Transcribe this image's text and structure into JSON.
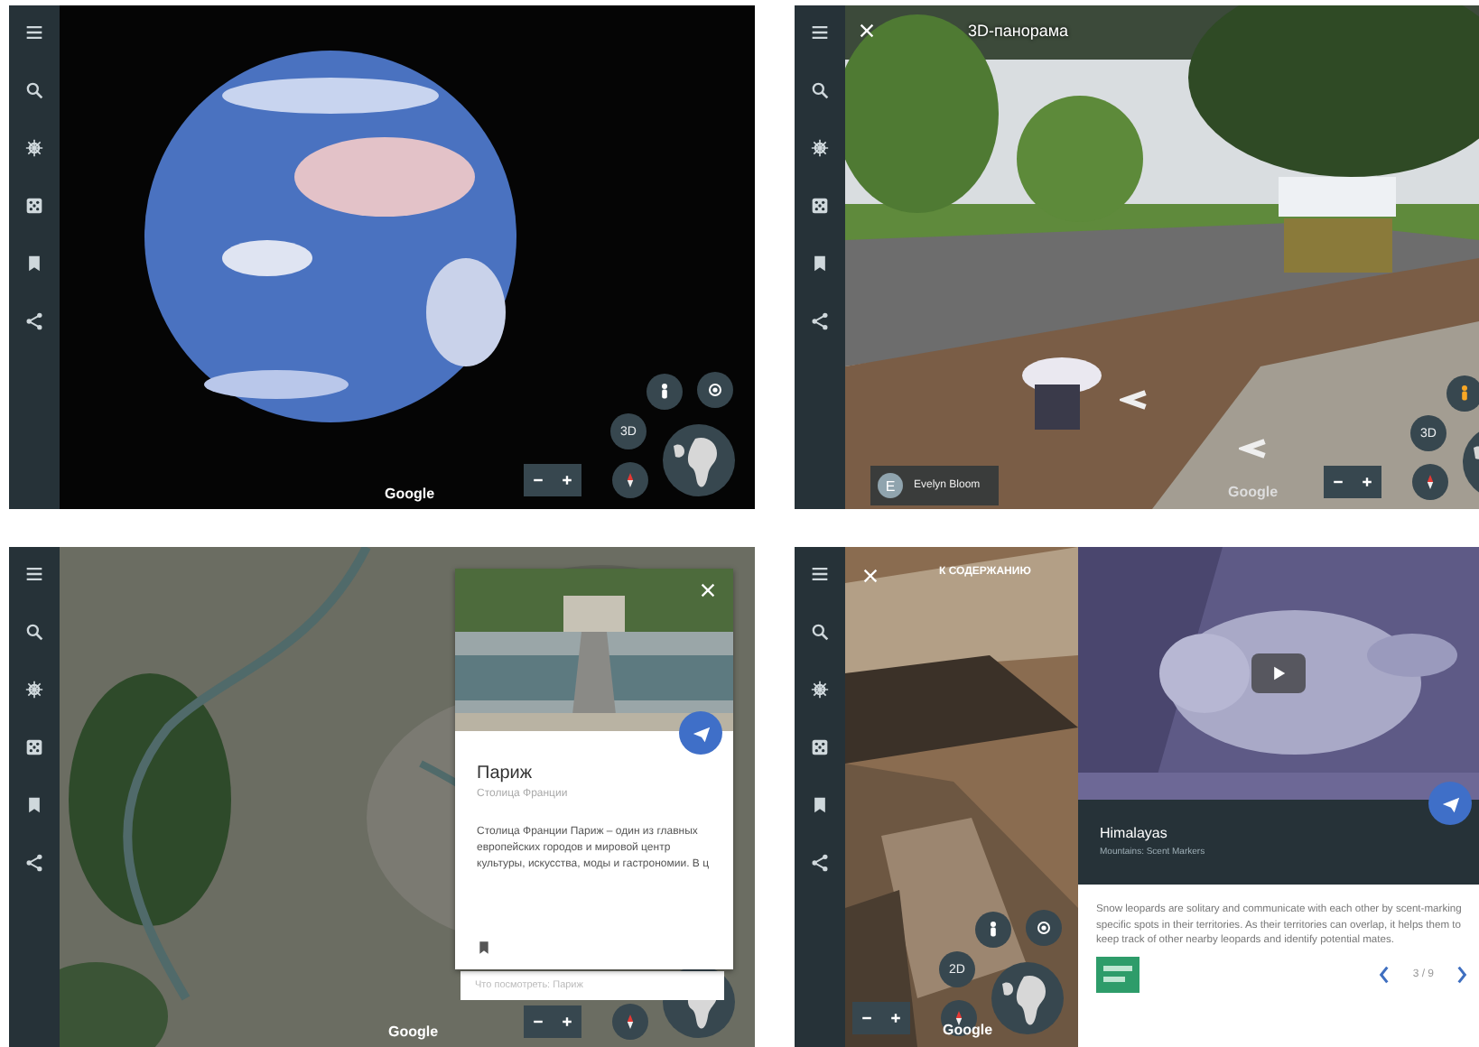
{
  "panels": [
    {
      "kind": "globe",
      "controls": {
        "mode": "3D"
      },
      "logo": "Google"
    },
    {
      "kind": "panorama",
      "title": "3D-панорама",
      "author": {
        "initial": "E",
        "name": "Evelyn Bloom"
      },
      "controls": {
        "mode": "3D"
      },
      "logo": "Google"
    },
    {
      "kind": "place",
      "card": {
        "title": "Париж",
        "subtitle": "Столица Франции",
        "description": "Столица Франции Париж – один из главных европейских городов и мировой центр культуры, искусства, моды и гастрономии. В ц"
      },
      "search": {
        "placeholder": "Что посмотреть: Париж"
      },
      "logo": "Google"
    },
    {
      "kind": "story",
      "back": "К СОДЕРЖАНИЮ",
      "card": {
        "title": "Himalayas",
        "subtitle": "Mountains: Scent Markers",
        "description": "Snow leopards are solitary and communicate with each other by scent-marking specific spots in their territories. As their territories can overlap, it helps them to keep track of other nearby leopards and identify potential mates."
      },
      "pager": "3 / 9",
      "controls": {
        "mode": "2D"
      },
      "logo": "Google"
    }
  ]
}
